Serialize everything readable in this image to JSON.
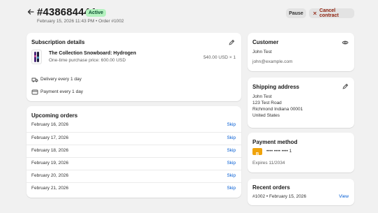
{
  "header": {
    "title": "#438684444",
    "status": "Active",
    "subtitle": "February 15, 2026 11:43 PM • Order #1002",
    "pause_label": "Pause",
    "cancel_label": "Cancel contract"
  },
  "subscription": {
    "heading": "Subscription details",
    "product_name": "The Collection Snowboard: Hydrogen",
    "product_price_note": "One-time purchase price: 600.00 USD",
    "line_total": "540.00 USD × 1",
    "delivery": "Delivery every 1 day",
    "payment": "Payment every 1 day"
  },
  "upcoming": {
    "heading": "Upcoming orders",
    "skip_label": "Skip",
    "orders": [
      "February 16, 2026",
      "February 17, 2026",
      "February 18, 2026",
      "February 19, 2026",
      "February 20, 2026",
      "February 21, 2026"
    ]
  },
  "customer": {
    "heading": "Customer",
    "name": "John Test",
    "email": "john@example.com"
  },
  "shipping": {
    "heading": "Shipping address",
    "lines": [
      "John Test",
      "123 Test Road",
      "Richmond Indiana 00001",
      "United States"
    ]
  },
  "payment_method": {
    "heading": "Payment method",
    "card_masked": "•••• •••• •••• 1",
    "expires": "Expires 11/2034"
  },
  "recent_orders": {
    "heading": "Recent orders",
    "order": "#1002 • February 15, 2026",
    "view_label": "View"
  },
  "colors": {
    "accent_link": "#005bd3",
    "active_badge_bg": "#b4f2bf",
    "cancel_text": "#8e1f0b",
    "card_brand": "#f0a30a"
  },
  "icons": [
    "back-arrow-icon",
    "x-icon",
    "edit-icon",
    "snowboard-thumbnail",
    "truck-icon",
    "card-icon",
    "eye-icon",
    "card-brand-icon"
  ]
}
